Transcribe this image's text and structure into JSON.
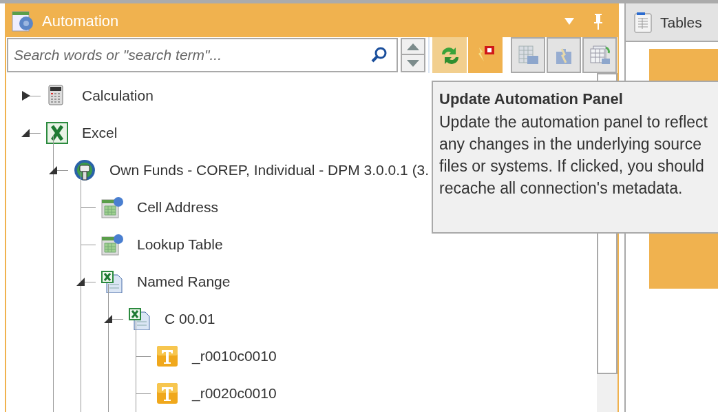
{
  "panel": {
    "title": "Automation"
  },
  "search": {
    "placeholder": "Search words or \"search term\"..."
  },
  "toolbar": [
    {
      "kind": "refresh",
      "highlighted": true
    },
    {
      "kind": "flag",
      "highlighted": false
    },
    {
      "kind": "grid",
      "highlighted": false
    },
    {
      "kind": "puzzle",
      "highlighted": false
    },
    {
      "kind": "sheets",
      "highlighted": false
    }
  ],
  "tree": [
    {
      "label": "Calculation",
      "kind": "calculation",
      "expanded": false
    },
    {
      "label": "Excel",
      "kind": "excel",
      "expanded": true,
      "children": [
        {
          "label": "Own Funds - COREP, Individual - DPM 3.0.0.1 (3.",
          "kind": "connection",
          "expanded": true,
          "children": [
            {
              "label": "Cell Address",
              "kind": "cell"
            },
            {
              "label": "Lookup Table",
              "kind": "cell"
            },
            {
              "label": "Named Range",
              "kind": "range",
              "expanded": true,
              "children": [
                {
                  "label": "C 00.01",
                  "kind": "range",
                  "expanded": true,
                  "children": [
                    {
                      "label": "_r0010c0010",
                      "kind": "field"
                    },
                    {
                      "label": "_r0020c0010",
                      "kind": "field"
                    }
                  ]
                }
              ]
            }
          ]
        }
      ]
    }
  ],
  "tooltip": {
    "title": "Update Automation Panel",
    "body": "Update the automation panel to reflect any changes in the underlying source files or systems. If clicked, you should recache all connection's metadata."
  },
  "side_panel": {
    "tab": "Tables"
  }
}
